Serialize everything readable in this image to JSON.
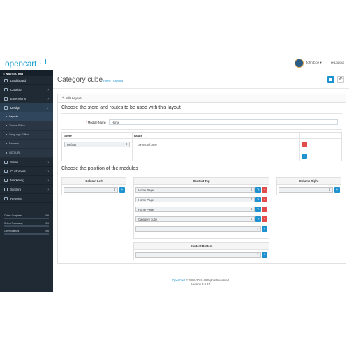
{
  "header": {
    "logo": "opencart",
    "user_name": "John Doe ▾",
    "logout_label": "↦ Logout"
  },
  "sidebar": {
    "nav_title": "≡ NAVIGATION",
    "items": [
      {
        "label": "Dashboard",
        "icon": "dashboard-icon"
      },
      {
        "label": "Catalog",
        "icon": "tag-icon"
      },
      {
        "label": "Extensions",
        "icon": "puzzle-icon"
      },
      {
        "label": "Design",
        "icon": "monitor-icon"
      }
    ],
    "design_sub": [
      "Layouts",
      "Theme Editor",
      "Language Editor",
      "Banners",
      "SEO URL"
    ],
    "items_after": [
      {
        "label": "Sales",
        "icon": "cart-icon"
      },
      {
        "label": "Customers",
        "icon": "user-icon"
      },
      {
        "label": "Marketing",
        "icon": "share-icon"
      },
      {
        "label": "System",
        "icon": "gear-icon"
      },
      {
        "label": "Reports",
        "icon": "chart-icon"
      }
    ],
    "stats": [
      {
        "label": "Orders Completed",
        "value": "0%",
        "fill": 0.0
      },
      {
        "label": "Orders Processing",
        "value": "0%",
        "fill": 0.0
      },
      {
        "label": "Other Statuses",
        "value": "0%",
        "fill": 0.0
      }
    ]
  },
  "page": {
    "title": "Category cube",
    "crumb_home": "Home",
    "crumb_sep": "›",
    "crumb_current": "Layouts",
    "back_icon": "↶"
  },
  "panel": {
    "heading": "✎ Edit Layout",
    "section1_title": "Choose the store and routes to be used with this layout",
    "module_name_label": "Module Name",
    "module_name_required": "*",
    "module_name_value": "Home",
    "route_table": {
      "col_store": "Store",
      "col_route": "Route",
      "rows": [
        {
          "store": "Default",
          "route": "common/home"
        }
      ]
    },
    "section2_title": "Choose the position of the modules",
    "positions": {
      "column_left": "Column Left",
      "content_top": "Content Top",
      "column_right": "Column Right",
      "content_bottom": "Content Bottom"
    },
    "content_top_modules": [
      "Home Page",
      "Home Page",
      "Home Page",
      "Category cube"
    ]
  },
  "footer": {
    "brand": "OpenCart",
    "copyright": " © 2009-2019 All Rights Reserved.",
    "version": "Version 3.0.3.1"
  }
}
